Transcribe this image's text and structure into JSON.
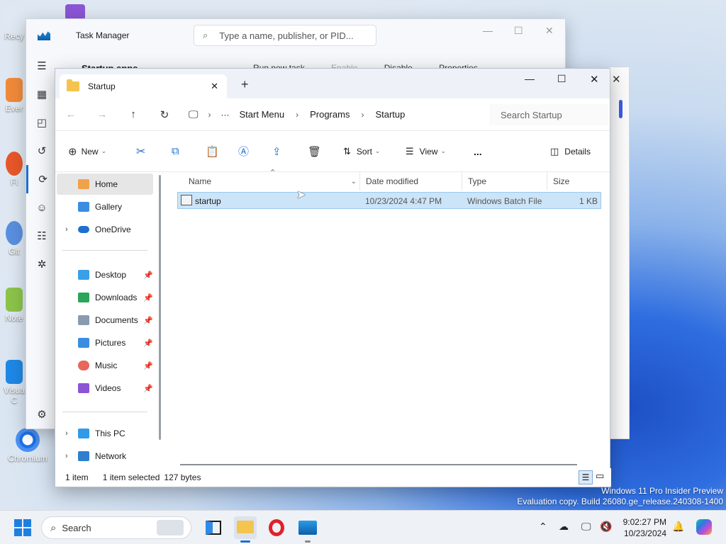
{
  "desktop": {
    "icons": [
      {
        "label": "Recy"
      },
      {
        "label": "Ever"
      },
      {
        "label": "Fi"
      },
      {
        "label": "Git"
      },
      {
        "label": "Note"
      },
      {
        "label": "Visua C"
      },
      {
        "label": "Chromium"
      }
    ]
  },
  "task_manager": {
    "title": "Task Manager",
    "search_placeholder": "Type a name, publisher, or PID...",
    "heading": "Startup apps",
    "toolbar": {
      "run_new_task": "Run new task",
      "enable": "Enable",
      "disable": "Disable",
      "properties": "Properties",
      "more": "..."
    }
  },
  "explorer": {
    "tab_title": "Startup",
    "new_tab": "+",
    "breadcrumb": [
      "Start Menu",
      "Programs",
      "Startup"
    ],
    "search_placeholder": "Search Startup",
    "commands": {
      "new": "New",
      "sort": "Sort",
      "view": "View",
      "more": "...",
      "details": "Details"
    },
    "nav": {
      "home": "Home",
      "gallery": "Gallery",
      "onedrive": "OneDrive",
      "desktop": "Desktop",
      "downloads": "Downloads",
      "documents": "Documents",
      "pictures": "Pictures",
      "music": "Music",
      "videos": "Videos",
      "this_pc": "This PC",
      "network": "Network"
    },
    "columns": {
      "name": "Name",
      "date_modified": "Date modified",
      "type": "Type",
      "size": "Size"
    },
    "files": [
      {
        "name": "startup",
        "date_modified": "10/23/2024 4:47 PM",
        "type": "Windows Batch File",
        "size": "1 KB"
      }
    ],
    "status": {
      "count": "1 item",
      "selected": "1 item selected",
      "bytes": "127 bytes"
    }
  },
  "watermark": {
    "line1": "Windows 11 Pro Insider Preview",
    "line2": "Evaluation copy. Build 26080.ge_release.240308-1400"
  },
  "taskbar": {
    "search_label": "Search",
    "clock_time": "9:02:27 PM",
    "clock_date": "10/23/2024"
  }
}
